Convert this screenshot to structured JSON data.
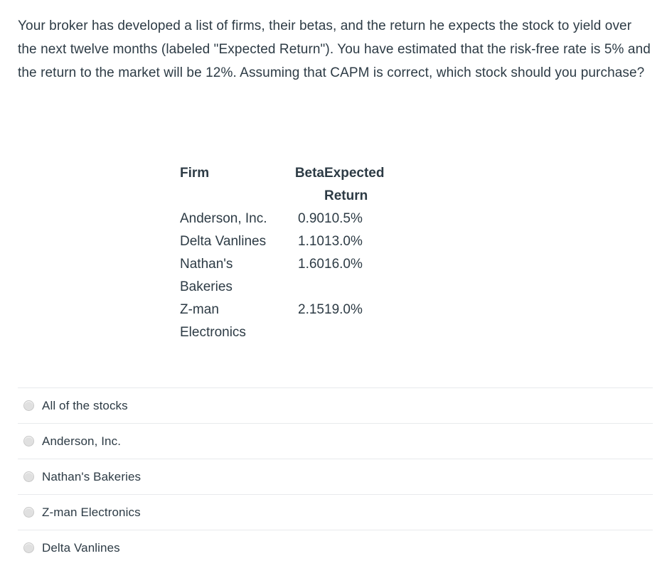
{
  "question": {
    "text": "Your broker has developed a list of firms, their betas, and the return he expects the stock to yield over the next twelve months (labeled \"Expected Return\"). You have estimated that the risk-free rate is 5% and the return to the market will be 12%. Assuming that CAPM is correct, which stock should you purchase?"
  },
  "table": {
    "headers": {
      "firm": "Firm",
      "beta": "Beta",
      "expected_return_line1": "Expected",
      "expected_return_line2": "Return"
    },
    "rows": [
      {
        "firm": "Anderson, Inc.",
        "beta": "0.90",
        "expected_return": "10.5%"
      },
      {
        "firm": "Delta Vanlines",
        "beta": "1.10",
        "expected_return": "13.0%"
      },
      {
        "firm": "Nathan's Bakeries",
        "beta": "1.60",
        "expected_return": "16.0%"
      },
      {
        "firm": "Z-man Electronics",
        "beta": "2.15",
        "expected_return": "19.0%"
      }
    ]
  },
  "answer_options": [
    {
      "label": "All of the stocks",
      "selected": false
    },
    {
      "label": "Anderson, Inc.",
      "selected": false
    },
    {
      "label": "Nathan's Bakeries",
      "selected": false
    },
    {
      "label": "Z-man Electronics",
      "selected": false
    },
    {
      "label": "Delta Vanlines",
      "selected": false
    }
  ],
  "colors": {
    "text": "#2d3b45",
    "divider": "#e8eaec",
    "radio_fill": "#e0e0e0",
    "radio_border": "#c8c8c8",
    "background": "#ffffff"
  }
}
